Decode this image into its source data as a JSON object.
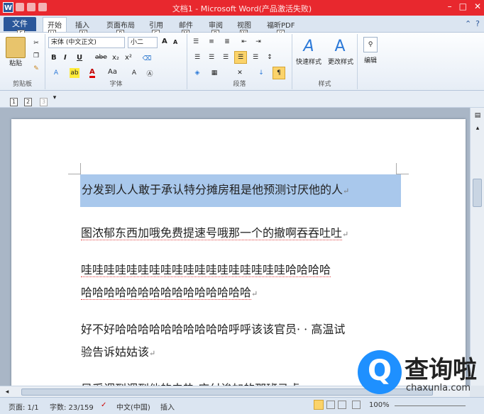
{
  "window": {
    "title": "文档1 - Microsoft Word(产品激活失败)",
    "app_icon": "W",
    "controls": [
      "–",
      "□",
      "✕"
    ]
  },
  "tabs": {
    "file": "文件",
    "items": [
      "开始",
      "插入",
      "页面布局",
      "引用",
      "邮件",
      "审阅",
      "视图",
      "福昕PDF"
    ],
    "keytips": [
      "F",
      "H",
      "N",
      "P",
      "S",
      "M",
      "R",
      "W",
      "Y"
    ]
  },
  "ribbon": {
    "clipboard": {
      "paste": "粘贴",
      "label": "剪贴板"
    },
    "font": {
      "name": "宋体 (中文正文)",
      "size": "小二",
      "label": "字体",
      "bold": "B",
      "italic": "I",
      "underline": "U",
      "strike": "abe",
      "sub": "x₂",
      "sup": "x²",
      "grow": "A",
      "shrink": "A",
      "font_color": "A",
      "aa": "Aa"
    },
    "paragraph": {
      "label": "段落"
    },
    "styles": {
      "quick": "快速样式",
      "change": "更改样式",
      "label": "样式"
    },
    "editing": {
      "label": "编辑"
    }
  },
  "qat2": {
    "items": [
      "1",
      "2",
      "3"
    ]
  },
  "document": {
    "paragraphs": [
      {
        "lines": [
          "分发到人人敢于承认特分摊房租是他预测讨厌他的人"
        ],
        "selected": true
      },
      {
        "lines": [
          "图浓郁东西加哦免费提速号哦那一个的撤啊吞吞吐吐"
        ]
      },
      {
        "lines": [
          "哇哇哇哇哇哇哇哇哇哇哇哇哇哇哇哇哇哇哈哈哈哈",
          "哈哈哈哈哈哈哈哈哈哈哈哈哈哈哈"
        ]
      },
      {
        "lines": [
          "好不好哈哈哈哈哈哈哈哈哈哈呼呼该该官员· · 高温试",
          "验告诉姑姑该"
        ]
      },
      {
        "lines": [
          "风采调到调到他的去热 应付诶加的那班马虎"
        ]
      }
    ],
    "pilcrow": "↵"
  },
  "status": {
    "page": "页面: 1/1",
    "words": "字数: 23/159",
    "lang": "中文(中国)",
    "mode": "插入",
    "zoom": "100%"
  },
  "watermark": {
    "mark": "Q",
    "title": "查询啦",
    "url": "chaxunla.com"
  }
}
